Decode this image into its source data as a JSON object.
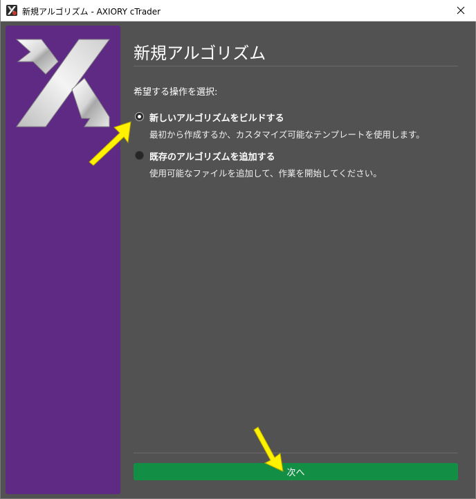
{
  "window": {
    "title": "新規アルゴリズム - AXIORY cTrader",
    "close_glyph": "✕"
  },
  "page": {
    "heading": "新規アルゴリズム",
    "prompt": "希望する操作を選択:"
  },
  "options": [
    {
      "label": "新しいアルゴリズムをビルドする",
      "description": "最初から作成するか、カスタマイズ可能なテンプレートを使用します。",
      "selected": true
    },
    {
      "label": "既存のアルゴリズムを追加する",
      "description": "使用可能なファイルを追加して、作業を開始してください。",
      "selected": false
    }
  ],
  "footer": {
    "next_label": "次へ"
  },
  "colors": {
    "banner": "#5e2a84",
    "background": "#525252",
    "next_button": "#138f45",
    "annotation_arrow": "#fff200"
  },
  "icons": {
    "app": "axiory-x-icon",
    "close": "close-icon",
    "logo": "axiory-x-logo"
  }
}
